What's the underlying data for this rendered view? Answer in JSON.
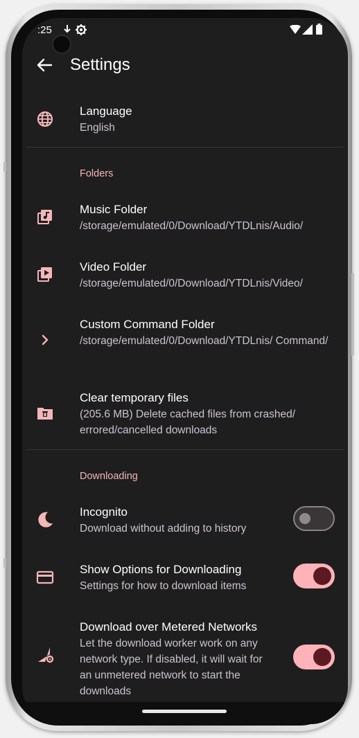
{
  "status_bar": {
    "time": ":25"
  },
  "app_bar": {
    "title": "Settings"
  },
  "language": {
    "title": "Language",
    "value": "English"
  },
  "sections": {
    "folders": "Folders",
    "downloading": "Downloading"
  },
  "music_folder": {
    "title": "Music Folder",
    "path": "/storage/emulated/0/Download/YTDLnis/Audio/"
  },
  "video_folder": {
    "title": "Video Folder",
    "path": "/storage/emulated/0/Download/YTDLnis/Video/"
  },
  "command_folder": {
    "title": "Custom Command Folder",
    "path": "/storage/emulated/0/Download/YTDLnis/ Command/"
  },
  "clear_temp": {
    "title": "Clear temporary files",
    "desc": "(205.6 MB) Delete cached files from crashed/ errored/cancelled downloads"
  },
  "incognito": {
    "title": "Incognito",
    "desc": "Download without adding to history",
    "enabled": false
  },
  "show_options": {
    "title": "Show Options for Downloading",
    "desc": "Settings for how to download items",
    "enabled": true
  },
  "metered": {
    "title": "Download over Metered Networks",
    "desc": "Let the download worker work on any network type. If disabled, it will wait for an unmetered network to start the downloads",
    "enabled": true
  },
  "colors": {
    "accent": "#f4b6b8",
    "switch_on_track": "#ffb3b9",
    "switch_on_thumb": "#5b1a22",
    "background": "#1e1e1e"
  },
  "icons": {
    "language": "globe-icon",
    "music": "music-folder-icon",
    "video": "video-folder-icon",
    "command": "chevron-right-icon",
    "clear": "folder-delete-icon",
    "incognito": "moon-icon",
    "show_options": "card-icon",
    "metered": "signal-settings-icon"
  }
}
